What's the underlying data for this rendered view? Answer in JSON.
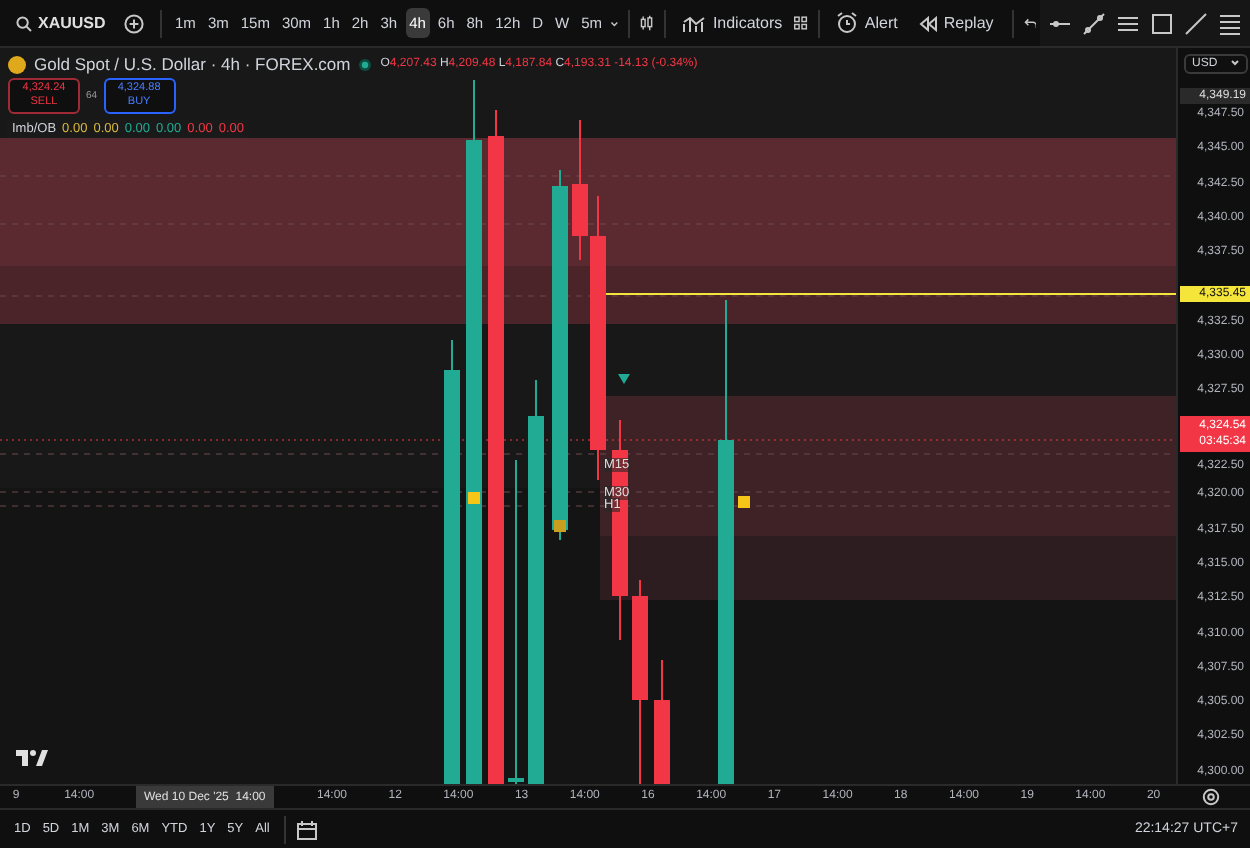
{
  "toolbar": {
    "symbol": "XAUUSD",
    "intervals": [
      {
        "label": "1m",
        "selected": false
      },
      {
        "label": "3m",
        "selected": false
      },
      {
        "label": "15m",
        "selected": false
      },
      {
        "label": "30m",
        "selected": false
      },
      {
        "label": "1h",
        "selected": false
      },
      {
        "label": "2h",
        "selected": false
      },
      {
        "label": "3h",
        "selected": false
      },
      {
        "label": "4h",
        "selected": true
      },
      {
        "label": "6h",
        "selected": false
      },
      {
        "label": "8h",
        "selected": false
      },
      {
        "label": "12h",
        "selected": false
      },
      {
        "label": "D",
        "selected": false
      },
      {
        "label": "W",
        "selected": false
      },
      {
        "label": "5m",
        "selected": false
      }
    ],
    "buttons": [
      {
        "kind": "indicators",
        "label": "Indicators"
      },
      {
        "kind": "alert",
        "label": "Alert"
      },
      {
        "kind": "replay",
        "label": "Replay"
      }
    ]
  },
  "legend": {
    "title": "Gold Spot / U.S. Dollar · 4h · FOREX.com",
    "ohlc": [
      {
        "key": "O",
        "value": "4,207.43"
      },
      {
        "key": "H",
        "value": "4,209.48"
      },
      {
        "key": "L",
        "value": "4,187.84"
      },
      {
        "key": "C",
        "value": "4,193.31"
      }
    ],
    "change": "-14.13 (-0.34%)"
  },
  "trade": {
    "sell_price": "4,324.24",
    "sell_label": "SELL",
    "spread": "64",
    "buy_price": "4,324.88",
    "buy_label": "BUY"
  },
  "indicator": {
    "name": "Imb/OB",
    "values": [
      {
        "value": "0.00",
        "color": "#d9b93b"
      },
      {
        "value": "0.00",
        "color": "#d9b93b"
      },
      {
        "value": "0.00",
        "color": "#22ab94"
      },
      {
        "value": "0.00",
        "color": "#22ab94"
      },
      {
        "value": "0.00",
        "color": "#f23645"
      },
      {
        "value": "0.00",
        "color": "#f23645"
      }
    ]
  },
  "chart_labels": [
    "M15",
    "M30",
    "H1"
  ],
  "price_axis": {
    "currency": "USD",
    "ticks": [
      "4,347.50",
      "4,345.00",
      "4,342.50",
      "4,340.00",
      "4,337.50",
      "4,332.50",
      "4,330.00",
      "4,327.50",
      "4,322.50",
      "4,320.00",
      "4,317.50",
      "4,315.00",
      "4,312.50",
      "4,310.00",
      "4,307.50",
      "4,305.00",
      "4,302.50",
      "4,300.00"
    ],
    "markers": [
      {
        "kind": "high",
        "price": "4,349.19"
      },
      {
        "kind": "alert",
        "price": "4,335.45"
      },
      {
        "kind": "last",
        "price": "4,324.54",
        "countdown": "03:45:34"
      }
    ]
  },
  "time_axis": {
    "labels": [
      "9",
      "14:00",
      "14:00",
      "12",
      "14:00",
      "13",
      "14:00",
      "16",
      "14:00",
      "17",
      "14:00",
      "18",
      "14:00",
      "19",
      "14:00",
      "20"
    ],
    "cursor": "Wed 10 Dec '25  14:00"
  },
  "ranges": [
    "1D",
    "5D",
    "1M",
    "3M",
    "6M",
    "YTD",
    "1Y",
    "5Y",
    "All"
  ],
  "clock": "22:14:27 UTC+7"
}
